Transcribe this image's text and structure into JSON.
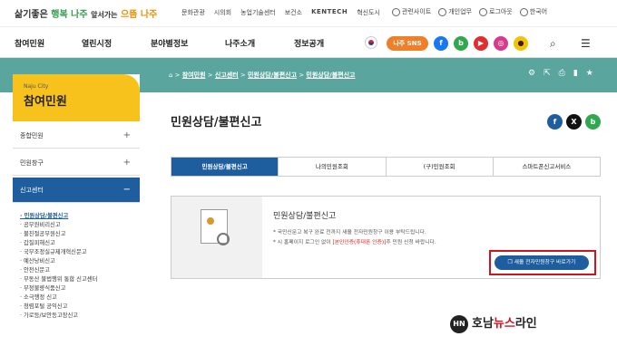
{
  "header": {
    "slogan_a": "삶기좋은",
    "slogan_b": "행복 나주",
    "slogan_c": "앞서가는",
    "slogan_d": "으뜸 나주",
    "links": [
      "문화관광",
      "시의회",
      "농업기술센터",
      "보건소",
      "KENTECH",
      "혁신도시"
    ],
    "utils": [
      "관련사이트",
      "개인업무",
      "로그아웃",
      "한국어"
    ]
  },
  "gnb": {
    "items": [
      "참여민원",
      "열린시정",
      "분야별정보",
      "나주소개",
      "정보공개"
    ],
    "sns_label": "나주 SNS",
    "sns": [
      "f",
      "b",
      "▶",
      "◎",
      "●"
    ]
  },
  "breadcrumb": [
    "참여민원",
    "신고센터",
    "민원상담/불편신고",
    "민원상담/불편신고"
  ],
  "sidebar": {
    "en": "Naju City",
    "title": "참여민원",
    "menu": [
      "종합민원",
      "민원창구",
      "신고센터"
    ],
    "sub": [
      "민원상담/불편신고",
      "공무원비리신고",
      "불친절공무원신고",
      "갑질피해신고",
      "국무조정실규제개혁신문고",
      "예산낭비신고",
      "안전신문고",
      "부동산 불법행위 통합 신고센터",
      "부정불량식품신고",
      "소극행정 신고",
      "청렴포털 공익신고",
      "가로등/보안등고장신고"
    ]
  },
  "page": {
    "title": "민원상담/불편신고",
    "tabs": [
      "민원상담/불편신고",
      "나의민원조회",
      "(구)민원조회",
      "스마트폰신고서비스"
    ],
    "card": {
      "title": "민원상담/불편신고",
      "line1": "* 국민신문고 복구 완료 전까지 새올 전자민원창구 이용 부탁드립니다.",
      "line2_a": "* 시 홈페이지 로그인 없이 ",
      "line2_red": "[본인인증(휴대폰 인증)]",
      "line2_b": "후 민원 신청 바랍니다.",
      "button": "새올 전자민원창구 바로가기"
    }
  },
  "watermark": {
    "badge": "HN",
    "a": "호남",
    "b": "뉴스",
    "c": "라인"
  }
}
